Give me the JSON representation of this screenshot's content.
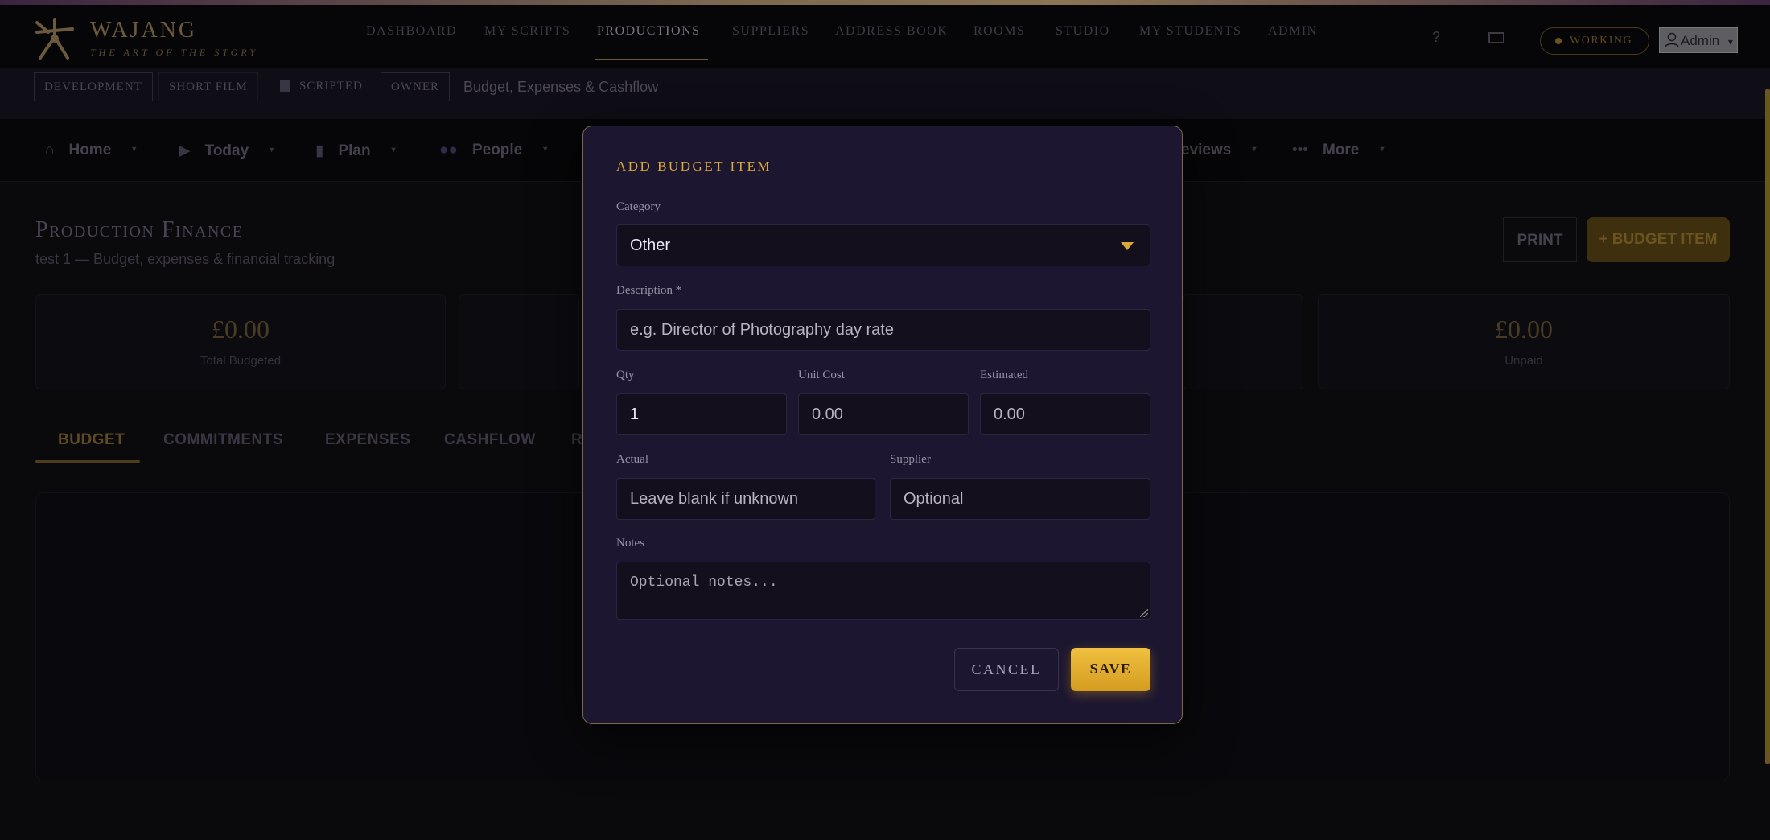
{
  "app": {
    "name": "WAJANG",
    "tagline": "THE ART OF THE STORY"
  },
  "nav": {
    "items": [
      "DASHBOARD",
      "MY SCRIPTS",
      "PRODUCTIONS",
      "SUPPLIERS",
      "ADDRESS BOOK",
      "ROOMS",
      "STUDIO",
      "MY STUDENTS",
      "ADMIN"
    ],
    "active": "PRODUCTIONS",
    "help": "?",
    "status": "WORKING",
    "user": "Admin",
    "user_caret": "▾"
  },
  "breadcrumb": {
    "chips": [
      "DEVELOPMENT",
      "SHORT FILM",
      "SCRIPTED",
      "OWNER"
    ],
    "title": "Budget, Expenses & Cashflow"
  },
  "section_tabs": {
    "items": [
      "Home",
      "Today",
      "Plan",
      "People",
      "eviews",
      "More"
    ],
    "icons": [
      "home-icon",
      "play-icon",
      "document-icon",
      "people-icon",
      "",
      "ellipsis-icon"
    ],
    "caret": "▾"
  },
  "page": {
    "title": "Production Finance",
    "subtitle": "test 1 — Budget, expenses & financial tracking",
    "print_label": "PRINT",
    "add_label": "+ BUDGET ITEM",
    "stats": [
      {
        "value": "£0.00",
        "label": "Total Budgeted"
      },
      {
        "value": "£0.00",
        "label": "Unpaid"
      }
    ],
    "finance_tabs": [
      "BUDGET",
      "COMMITMENTS",
      "EXPENSES",
      "CASHFLOW",
      "R"
    ]
  },
  "modal": {
    "title": "ADD BUDGET ITEM",
    "category": {
      "label": "Category",
      "value": "Other"
    },
    "description": {
      "label": "Description *",
      "placeholder": "e.g. Director of Photography day rate"
    },
    "qty": {
      "label": "Qty",
      "value": "1"
    },
    "unit_cost": {
      "label": "Unit Cost",
      "placeholder": "0.00"
    },
    "estimated": {
      "label": "Estimated",
      "placeholder": "0.00"
    },
    "actual": {
      "label": "Actual",
      "placeholder": "Leave blank if unknown"
    },
    "supplier": {
      "label": "Supplier",
      "placeholder": "Optional"
    },
    "notes": {
      "label": "Notes",
      "placeholder": "Optional notes..."
    },
    "cancel_label": "CANCEL",
    "save_label": "SAVE"
  },
  "colors": {
    "accent": "#d9a93a",
    "modal_bg": "#1c1630",
    "page_bg": "#0a090c"
  }
}
